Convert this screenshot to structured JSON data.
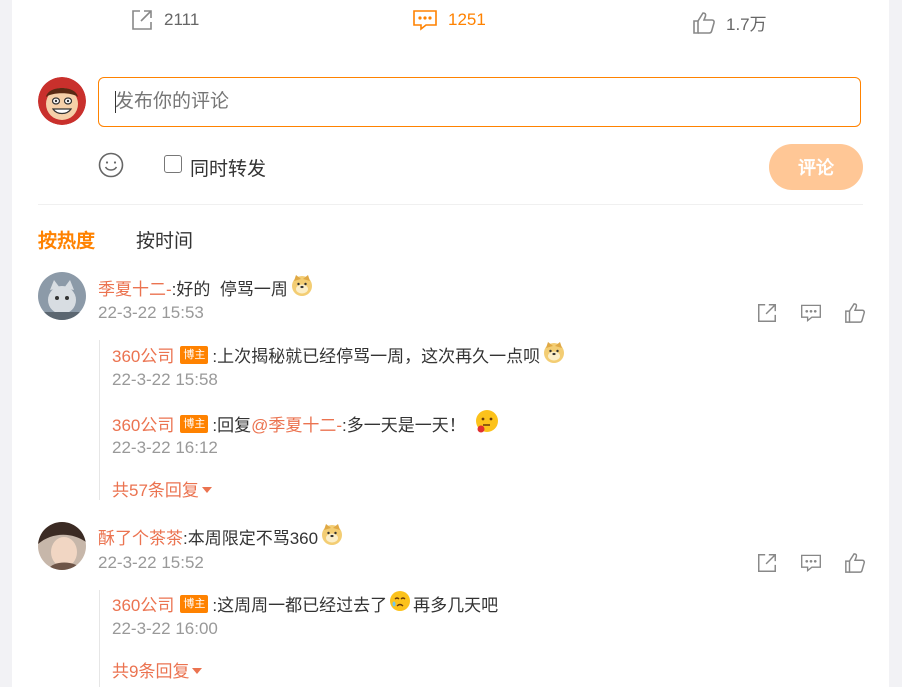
{
  "actions": {
    "forward_count": "2111",
    "comment_count": "1251",
    "like_count": "1.7万"
  },
  "compose": {
    "placeholder": "发布你的评论",
    "repost_label": "同时转发",
    "submit_label": "评论"
  },
  "sort": {
    "hot_label": "按热度",
    "time_label": "按时间"
  },
  "comments": [
    {
      "user": "季夏十二-",
      "text": ":好的  停骂一周",
      "time": "22-3-22 15:53",
      "replies": [
        {
          "user": "360公司",
          "badge": "博主",
          "text": ":上次揭秘就已经停骂一周，这次再久一点呗",
          "time": "22-3-22 15:58"
        },
        {
          "user": "360公司",
          "badge": "博主",
          "text_pre": ":回复",
          "mention": "@季夏十二-",
          "text": ":多一天是一天！",
          "time": "22-3-22 16:12"
        }
      ],
      "more_replies": "共57条回复"
    },
    {
      "user": "酥了个茶茶",
      "text": ":本周限定不骂360",
      "time": "22-3-22 15:52",
      "replies": [
        {
          "user": "360公司",
          "badge": "博主",
          "text": ":这周周一都已经过去了",
          "text_after": "再多几天吧",
          "time": "22-3-22 16:00"
        }
      ],
      "more_replies": "共9条回复"
    }
  ],
  "colors": {
    "accent": "#ff8200",
    "username": "#eb7350",
    "submit_disabled": "#ffc796"
  }
}
